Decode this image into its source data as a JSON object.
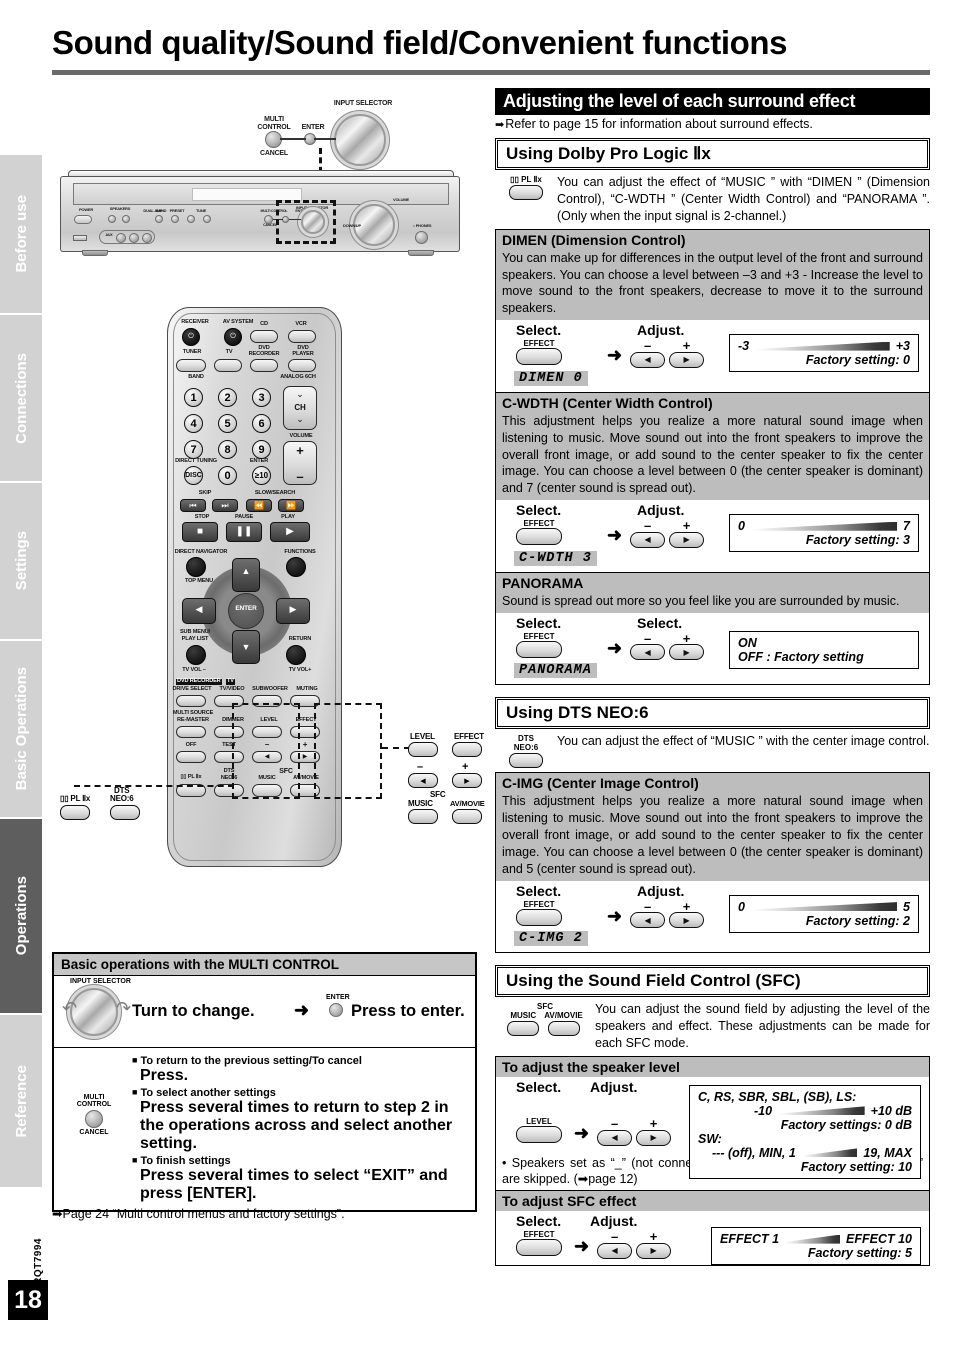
{
  "page": {
    "title": "Sound quality/Sound field/Convenient functions",
    "number": "18",
    "doc_code": "RQT7994"
  },
  "side_tabs": [
    {
      "label": "Before use",
      "active": false
    },
    {
      "label": "Connections",
      "active": false
    },
    {
      "label": "Settings",
      "active": false
    },
    {
      "label": "Basic Operations",
      "active": false
    },
    {
      "label": "Operations",
      "active": true
    },
    {
      "label": "Reference",
      "active": false
    }
  ],
  "unit_diagram": {
    "multi_control": "MULTI\nCONTROL",
    "multi_control_l1": "MULTI",
    "multi_control_l2": "CONTROL",
    "enter": "ENTER",
    "cancel": "CANCEL",
    "input_selector": "INPUT SELECTOR",
    "front_labels": {
      "power": "POWER",
      "power_sym": "⏻/I",
      "speakers": "SPEAKERS",
      "a": "A",
      "b": "B",
      "dual_amp": "DUAL AMP",
      "bi_amp": "BI-AMP",
      "band": "BAND",
      "preset": "PRESET",
      "tune": "TUNE",
      "aux": "AUX",
      "volume": "VOLUME",
      "down_up": "DOWN/UP",
      "phones": "⌂ PHONES",
      "input_selector": "INPUT SELECTOR",
      "multi_control": "MULTI CONTROL",
      "enter": "ENTER",
      "cancel": "CANCEL"
    }
  },
  "remote": {
    "receiver": "RECEIVER",
    "av_system": "AV SYSTEM",
    "cd": "CD",
    "vcr": "VCR",
    "tuner": "TUNER",
    "tv": "TV",
    "dvd_recorder_l1": "DVD",
    "dvd_recorder_l2": "RECORDER",
    "dvd_player_l1": "DVD",
    "dvd_player_l2": "PLAYER",
    "band": "BAND",
    "analog_6ch": "ANALOG 6CH",
    "numbers": [
      "1",
      "2",
      "3",
      "4",
      "5",
      "6",
      "7",
      "8",
      "9",
      "0"
    ],
    "ch": "CH",
    "volume": "VOLUME",
    "direct_tuning": "DIRECT TUNING",
    "disc": "DISC",
    "enter_small": "ENTER",
    "ten_key": "≥10",
    "skip": "SKIP",
    "slow_search": "SLOW/SEARCH",
    "stop": "STOP",
    "pause": "PAUSE",
    "play": "PLAY",
    "direct_navigator": "DIRECT NAVIGATOR",
    "functions": "FUNCTIONS",
    "top_menu": "TOP MENU",
    "enter": "ENTER",
    "sub_menu_l1": "SUB MENU/",
    "sub_menu_l2": "PLAY LIST",
    "return": "RETURN",
    "tv_vol_minus": "TV VOL –",
    "tv_vol_plus": "TV VOL+",
    "dvd_recorder_tag": "DVD RECORDER",
    "tv_tag": "TV",
    "drive_select": "DRIVE SELECT",
    "tv_video": "TV/VIDEO",
    "subwoofer": "SUBWOOFER",
    "muting": "MUTING",
    "multi_source_l1": "MULTI SOURCE",
    "multi_source_l2": "RE-MASTER",
    "dimmer": "DIMMER",
    "level": "LEVEL",
    "effect": "EFFECT",
    "off": "OFF",
    "test": "TEST",
    "minus": "–",
    "plus": "+",
    "pl2x": "▯▯ PL Ⅱx",
    "dts_l1": "DTS",
    "dts_l2": "NEO:6",
    "sfc": "SFC",
    "music": "MUSIC",
    "av_movie": "AV/MOVIE"
  },
  "callouts": {
    "level": "LEVEL",
    "effect": "EFFECT",
    "minus": "–",
    "plus": "+",
    "sfc": "SFC",
    "music": "MUSIC",
    "av_movie": "AV/MOVIE",
    "pl2x": "▯▯ PL Ⅱx",
    "dts_l1": "DTS",
    "dts_l2": "NEO:6"
  },
  "multi_control_panel": {
    "heading": "Basic operations with the MULTI CONTROL",
    "input_selector_label": "INPUT SELECTOR",
    "turn_text": "Turn to change.",
    "arrow": "➜",
    "enter_label": "ENTER",
    "press_text": "Press to enter.",
    "knob_label_l1": "MULTI",
    "knob_label_l2": "CONTROL",
    "knob_label_l3": "CANCEL",
    "bullets": [
      {
        "head": "To return to the previous setting/To cancel",
        "body": "Press."
      },
      {
        "head": "To select another settings",
        "body": "Press several times to return to step 2 in the operations across and select another setting."
      },
      {
        "head": "To finish settings",
        "body": "Press several times to select “EXIT” and press [ENTER]."
      }
    ],
    "footnote": "Page 24 “Multi control menus and factory settings”."
  },
  "right": {
    "black_heading": "Adjusting the level of each surround effect",
    "refer_note": "Refer to page 15 for information about surround effects.",
    "sections": [
      {
        "title": "Using Dolby Pro Logic Ⅱx",
        "intro_btn_label": "▯▯ PL Ⅱx",
        "intro_text": "You can adjust the effect of “MUSIC ” with “DIMEN ” (Dimension Control), “C-WDTH ” (Center Width Control) and “PANORAMA ”. (Only when the input signal is 2-channel.)",
        "panels": [
          {
            "head": "DIMEN (Dimension Control)",
            "desc": "You can make up for differences in the output level of the front and surround speakers. You can choose a level between –3 and +3 - Increase the level to move sound to the front speakers, decrease to move it to the surround speakers.",
            "step1_label": "Select.",
            "step2_label": "Adjust.",
            "select_btn": "EFFECT",
            "arrow": "➜",
            "minus": "–",
            "plus": "+",
            "display": "DIMEN  0",
            "range_min": "-3",
            "range_max": "+3",
            "factory": "Factory setting: 0"
          },
          {
            "head": "C-WDTH (Center Width Control)",
            "desc": "This adjustment helps you realize a more natural sound image when listening to music. Move sound out into the front speakers to improve the overall front image, or add sound to the center speaker to fix the center image. You can choose a level between 0 (the center speaker is dominant) and 7 (center sound is spread out).",
            "step1_label": "Select.",
            "step2_label": "Adjust.",
            "select_btn": "EFFECT",
            "arrow": "➜",
            "minus": "–",
            "plus": "+",
            "display": "C-WDTH 3",
            "range_min": "0",
            "range_max": "7",
            "factory": "Factory setting: 3"
          },
          {
            "head": "PANORAMA",
            "desc": "Sound is spread out more so you feel like you are surrounded by music.",
            "step1_label": "Select.",
            "step2_label": "Select.",
            "select_btn": "EFFECT",
            "arrow": "➜",
            "minus": "–",
            "plus": "+",
            "display": "PANORAMA",
            "on_label": "ON",
            "off_label": "OFF : Factory setting"
          }
        ]
      },
      {
        "title": "Using DTS NEO:6",
        "intro_btn_l1": "DTS",
        "intro_btn_l2": "NEO:6",
        "intro_text": "You can adjust the effect of “MUSIC ” with the center image control.",
        "panels": [
          {
            "head": "C-IMG (Center Image Control)",
            "desc": "This adjustment helps you realize a more natural sound image when listening to music. Move sound out into the front speakers to improve the overall front image, or add sound to the center speaker to fix the center image. You can choose a level between 0 (the center speaker is dominant) and 5 (center sound is spread out).",
            "step1_label": "Select.",
            "step2_label": "Adjust.",
            "select_btn": "EFFECT",
            "arrow": "➜",
            "minus": "–",
            "plus": "+",
            "display": "C-IMG  2",
            "range_min": "0",
            "range_max": "5",
            "factory": "Factory setting: 2"
          }
        ]
      },
      {
        "title": "Using the Sound Field Control (SFC)",
        "intro_btn_sfc": "SFC",
        "intro_btn_music": "MUSIC",
        "intro_btn_avmovie": "AV/MOVIE",
        "intro_text": "You can adjust the sound field by adjusting the level of the speakers and effect. These adjustments can be made for each SFC mode.",
        "panels": [
          {
            "head": "To adjust the speaker level",
            "step1_label": "Select.",
            "step2_label": "Adjust.",
            "select_btn": "LEVEL",
            "arrow": "➜",
            "minus": "–",
            "plus": "+",
            "spk_list": "C, RS, SBR, SBL, (SB), LS:",
            "spk_min": "-10",
            "spk_max": "+10 dB",
            "spk_factory": "Factory settings: 0 dB",
            "sw_label": "SW:",
            "sw_min": "--- (off), MIN, 1",
            "sw_max": "19, MAX",
            "sw_factory": "Factory setting: 10",
            "note": "Speakers set as “_” (not connected) in “Speakers combination settings”  are skipped. (➡page 12)"
          },
          {
            "head": "To adjust SFC effect",
            "step1_label": "Select.",
            "step2_label": "Adjust.",
            "select_btn": "EFFECT",
            "arrow": "➜",
            "minus": "–",
            "plus": "+",
            "range_min": "EFFECT 1",
            "range_max": "EFFECT 10",
            "factory": "Factory setting: 5"
          }
        ]
      }
    ]
  },
  "colors": {
    "accent_black": "#000000",
    "panel_gray": "#bdbdbd",
    "tab_gray": "#d2d2d2",
    "tab_active": "#5e5e5e",
    "rule_gray": "#6b6b6b"
  }
}
